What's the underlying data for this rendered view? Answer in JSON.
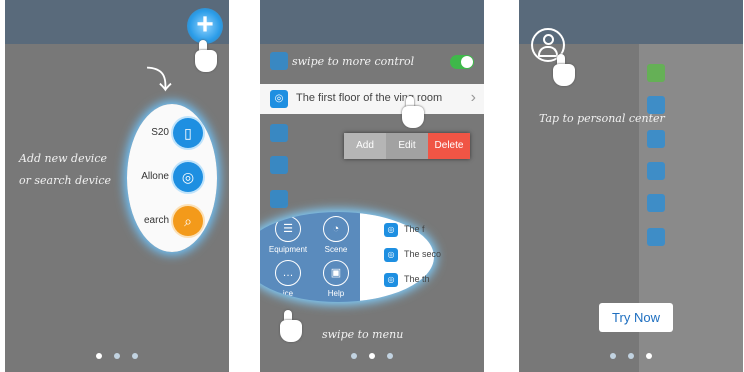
{
  "screen1": {
    "hint_line1": "Add new device",
    "hint_line2": "or search device",
    "add_button": "+",
    "menu": [
      {
        "label": "S20",
        "icon": "socket-icon"
      },
      {
        "label": "Allone",
        "icon": "allone-icon"
      },
      {
        "label": "earch",
        "icon": "search-icon"
      }
    ],
    "pager": {
      "count": 3,
      "active": 0
    }
  },
  "screen2": {
    "hint_top": "swipe to more control",
    "row_label": "The first floor of the  ving room",
    "actions": {
      "add": "Add",
      "edit": "Edit",
      "delete": "Delete"
    },
    "nav": [
      {
        "label": "Equipment",
        "icon": "equipment-icon"
      },
      {
        "label": "Scene",
        "icon": "scene-icon"
      },
      {
        "label": "ice",
        "icon": "more-icon"
      },
      {
        "label": "Help",
        "icon": "help-icon"
      }
    ],
    "mini_rows": [
      "The f",
      "The seco",
      "The th"
    ],
    "hint_bottom": "swipe to menu",
    "pager": {
      "count": 3,
      "active": 1
    }
  },
  "screen3": {
    "hint": "Tap to personal center",
    "try_button": "Try Now",
    "pager": {
      "count": 3,
      "active": 2
    }
  },
  "colors": {
    "accent": "#1e8fe1",
    "delete": "#f05545",
    "search": "#f39a1a",
    "toggle": "#3fb84a"
  }
}
